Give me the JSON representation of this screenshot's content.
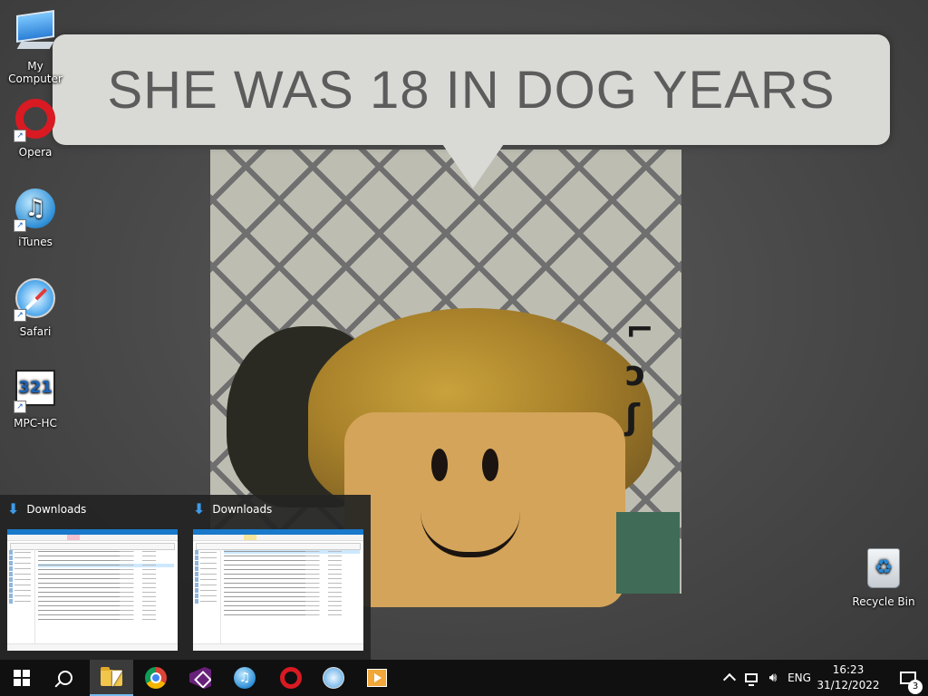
{
  "wallpaper": {
    "caption": "SHE WAS 18 IN DOG YEARS"
  },
  "desktop_icons": [
    {
      "label": "My Computer",
      "icon": "computer-icon"
    },
    {
      "label": "Opera",
      "icon": "opera-icon"
    },
    {
      "label": "iTunes",
      "icon": "itunes-icon"
    },
    {
      "label": "Safari",
      "icon": "safari-icon"
    },
    {
      "label": "MPC-HC",
      "icon": "mpc-hc-icon"
    },
    {
      "label": "Recycle Bin",
      "icon": "recycle-bin-icon"
    }
  ],
  "mpc_icon_text": "321",
  "thumbnails": [
    {
      "title": "Downloads",
      "icon": "download-arrow-icon"
    },
    {
      "title": "Downloads",
      "icon": "download-arrow-icon"
    }
  ],
  "taskbar": {
    "apps": [
      "start",
      "search",
      "file-explorer",
      "chrome",
      "visual-studio",
      "itunes",
      "opera",
      "safari",
      "mpc-hc"
    ],
    "active_app": "file-explorer"
  },
  "tray": {
    "language": "ENG",
    "time": "16:23",
    "date": "31/12/2022",
    "notification_count": "3"
  },
  "colors": {
    "taskbar": "#101010",
    "accent": "#76b9ed",
    "folder_blue": "#3d9be9"
  }
}
